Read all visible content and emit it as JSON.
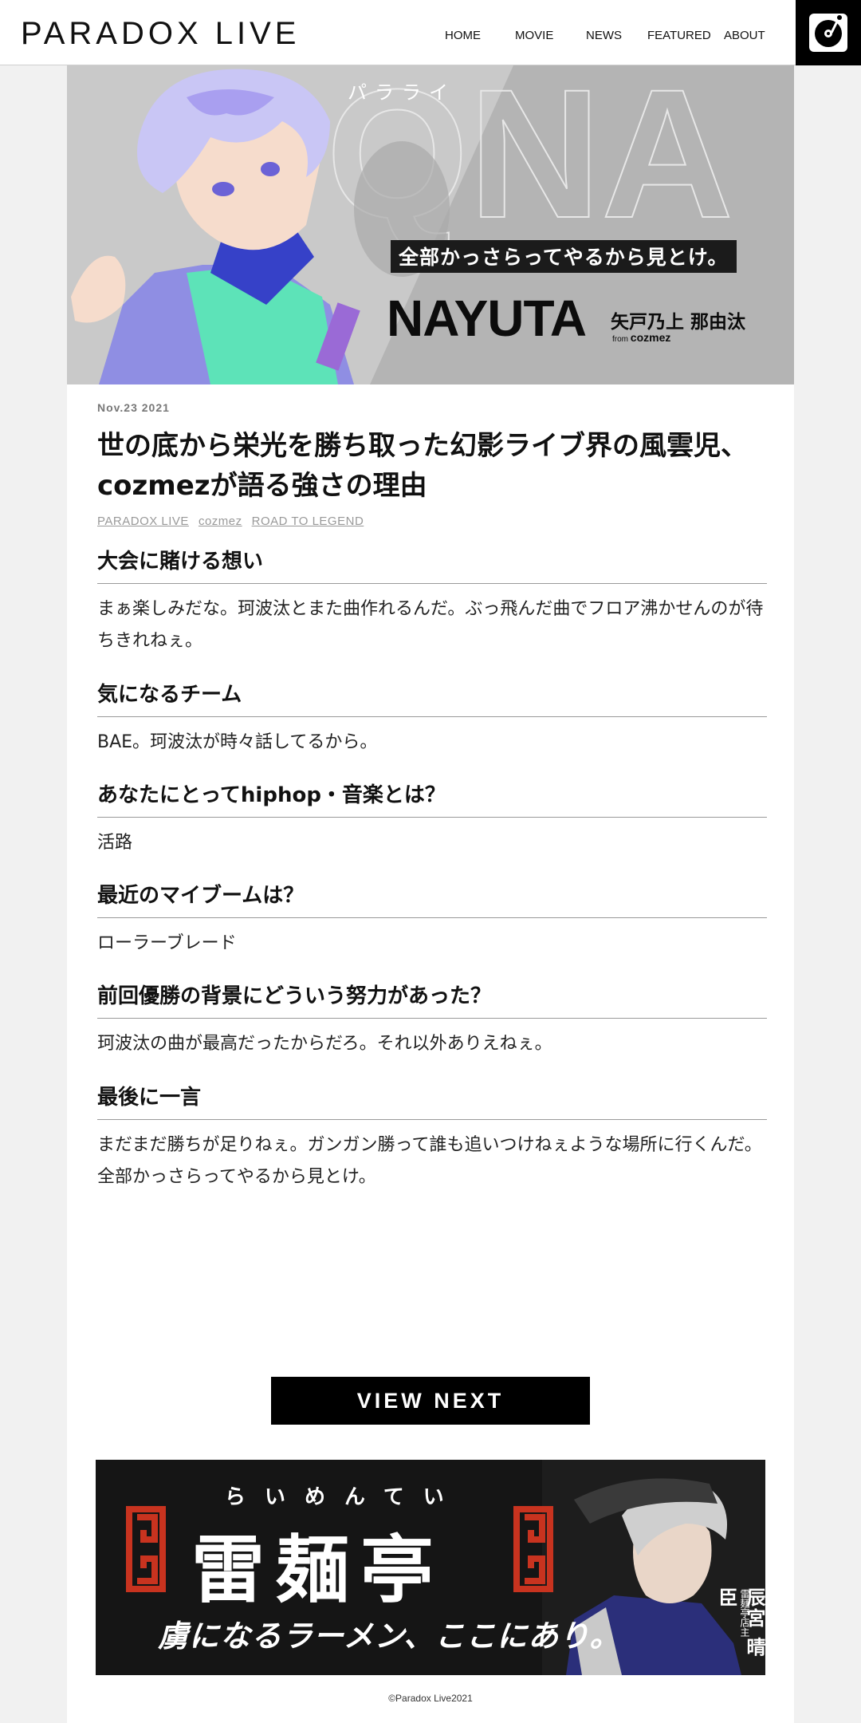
{
  "header": {
    "logo": "PARADOX LIVE",
    "nav": [
      "HOME",
      "MOVIE",
      "NEWS",
      "FEATURED",
      "ABOUT"
    ],
    "menu_icon": "record-icon"
  },
  "hero": {
    "logo_jp": "パラライ",
    "watermark": "QNA",
    "tagline": "全部かっさらってやるから見とけ。",
    "name": "NAYUTA",
    "kanji_name": "矢戸乃上 那由汰",
    "from_label": "from",
    "team": "cozmez"
  },
  "article": {
    "date": "Nov.23 2021",
    "title": "世の底から栄光を勝ち取った幻影ライブ界の風雲児、cozmezが語る強さの理由",
    "tags": [
      "PARADOX LIVE",
      "cozmez",
      "ROAD TO LEGEND"
    ],
    "qa": [
      {
        "q": "大会に賭ける想い",
        "a": "まぁ楽しみだな。珂波汰とまた曲作れるんだ。ぶっ飛んだ曲でフロア沸かせんのが待ちきれねぇ。"
      },
      {
        "q": "気になるチーム",
        "a": "BAE。珂波汰が時々話してるから。"
      },
      {
        "q": "あなたにとってhiphop・音楽とは？",
        "a": "活路"
      },
      {
        "q": "最近のマイブームは？",
        "a": "ローラーブレード"
      },
      {
        "q": "前回優勝の背景にどういう努力があった？",
        "a": "珂波汰の曲が最高だったからだろ。それ以外ありえねぇ。"
      },
      {
        "q": "最後に一言",
        "a": "まだまだ勝ちが足りねぇ。ガンガン勝って誰も追いつけねぇような場所に行くんだ。全部かっさらってやるから見とけ。"
      }
    ]
  },
  "view_next": "VIEW NEXT",
  "banner": {
    "kana": "らいめんてい",
    "title": "雷麺亭",
    "subtitle": "虜になるラーメン、ここにあり。",
    "role": "雷麺亭店主",
    "name": "辰宮 晴臣"
  },
  "footer": {
    "copyright": "©Paradox Live2021"
  },
  "colors": {
    "accent": "#000000",
    "hero_bg": "#c9c9c9",
    "banner_red": "#c8331f",
    "page_bg": "#f1f1f1"
  }
}
